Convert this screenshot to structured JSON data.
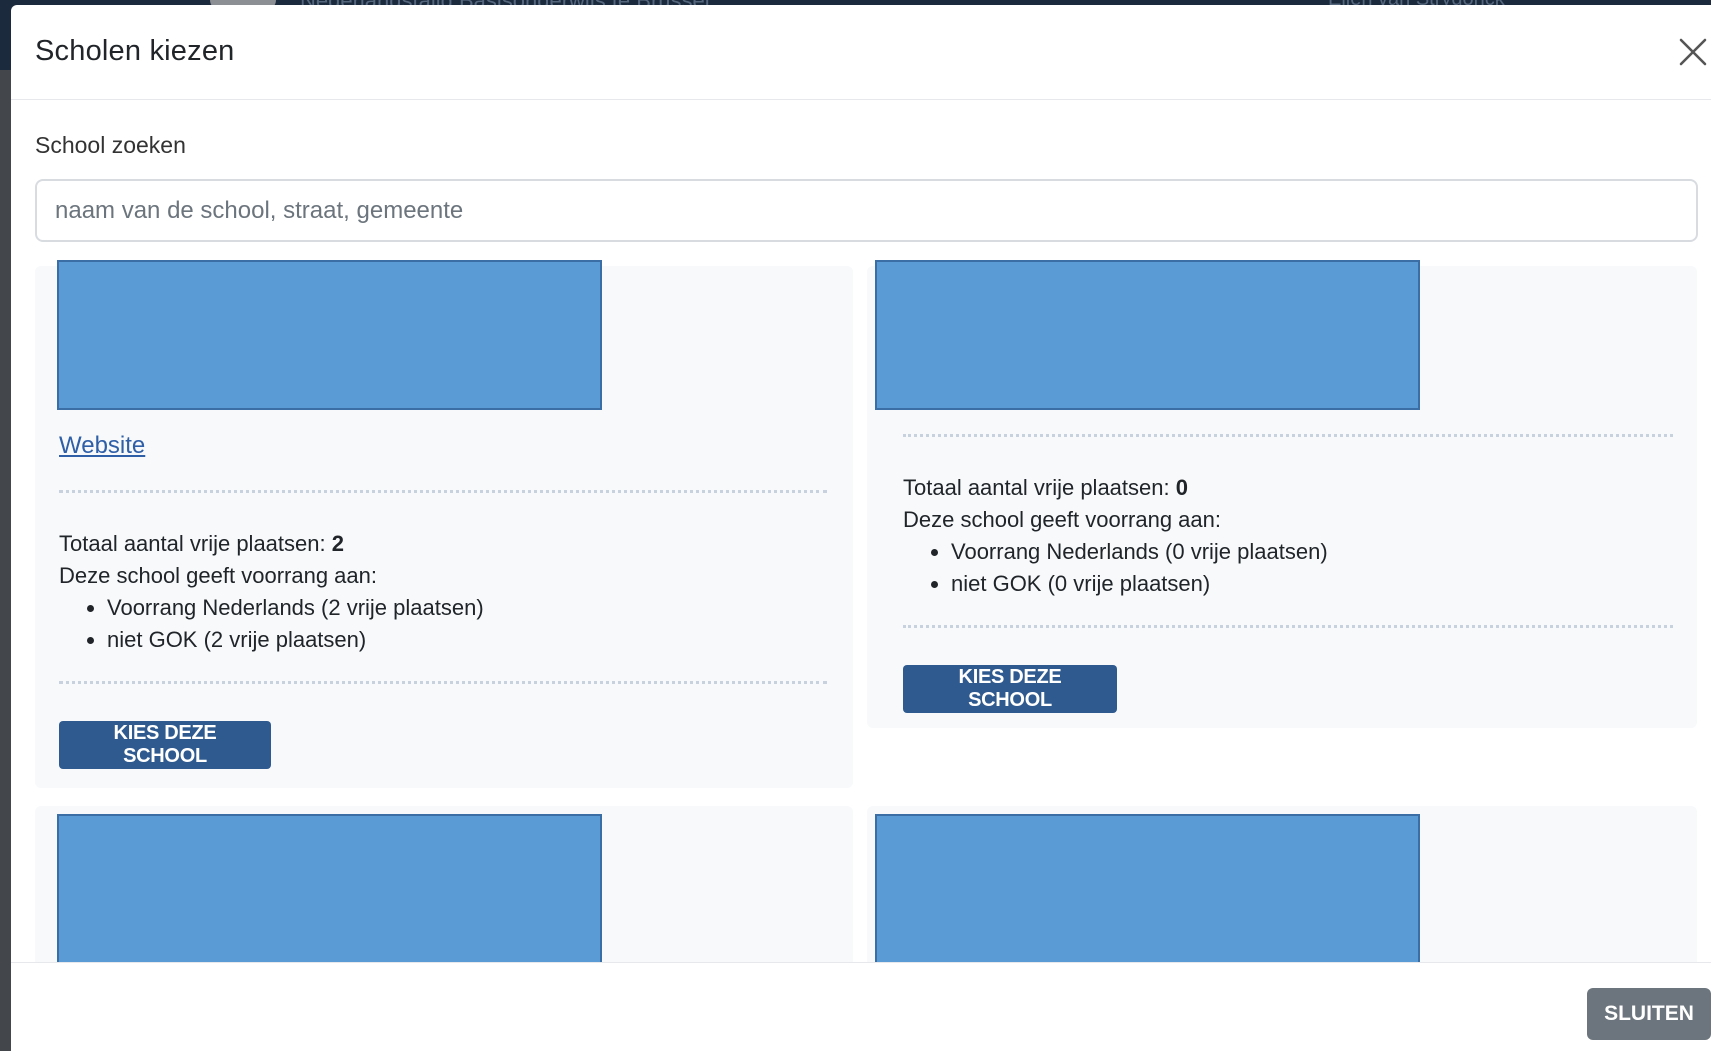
{
  "backdrop": {
    "page_title": "Nederlandstalig Basisonderwijs te Brussel",
    "user_name": "Ellen van Strydonck"
  },
  "modal": {
    "title": "Scholen kiezen",
    "close_icon": "close-icon"
  },
  "search": {
    "label": "School zoeken",
    "placeholder": "naam van de school, straat, gemeente",
    "value": ""
  },
  "schools": [
    {
      "website_label": "Website",
      "total_label": "Totaal aantal vrije plaatsen:",
      "total_value": "2",
      "priority_label": "Deze school geeft voorrang aan:",
      "priorities": [
        "Voorrang Nederlands (2 vrije plaatsen)",
        "niet GOK (2 vrije plaatsen)"
      ],
      "button_label": "KIES DEZE SCHOOL"
    },
    {
      "total_label": "Totaal aantal vrije plaatsen:",
      "total_value": "0",
      "priority_label": "Deze school geeft voorrang aan:",
      "priorities": [
        "Voorrang Nederlands (0 vrije plaatsen)",
        "niet GOK (0 vrije plaatsen)"
      ],
      "button_label": "KIES DEZE SCHOOL"
    }
  ],
  "footer": {
    "close_label": "SLUITEN"
  },
  "colors": {
    "primary_button": "#2e5a8f",
    "secondary_button": "#6c757d",
    "image_placeholder": "#5b9bd5",
    "link": "#2f5fa7"
  }
}
